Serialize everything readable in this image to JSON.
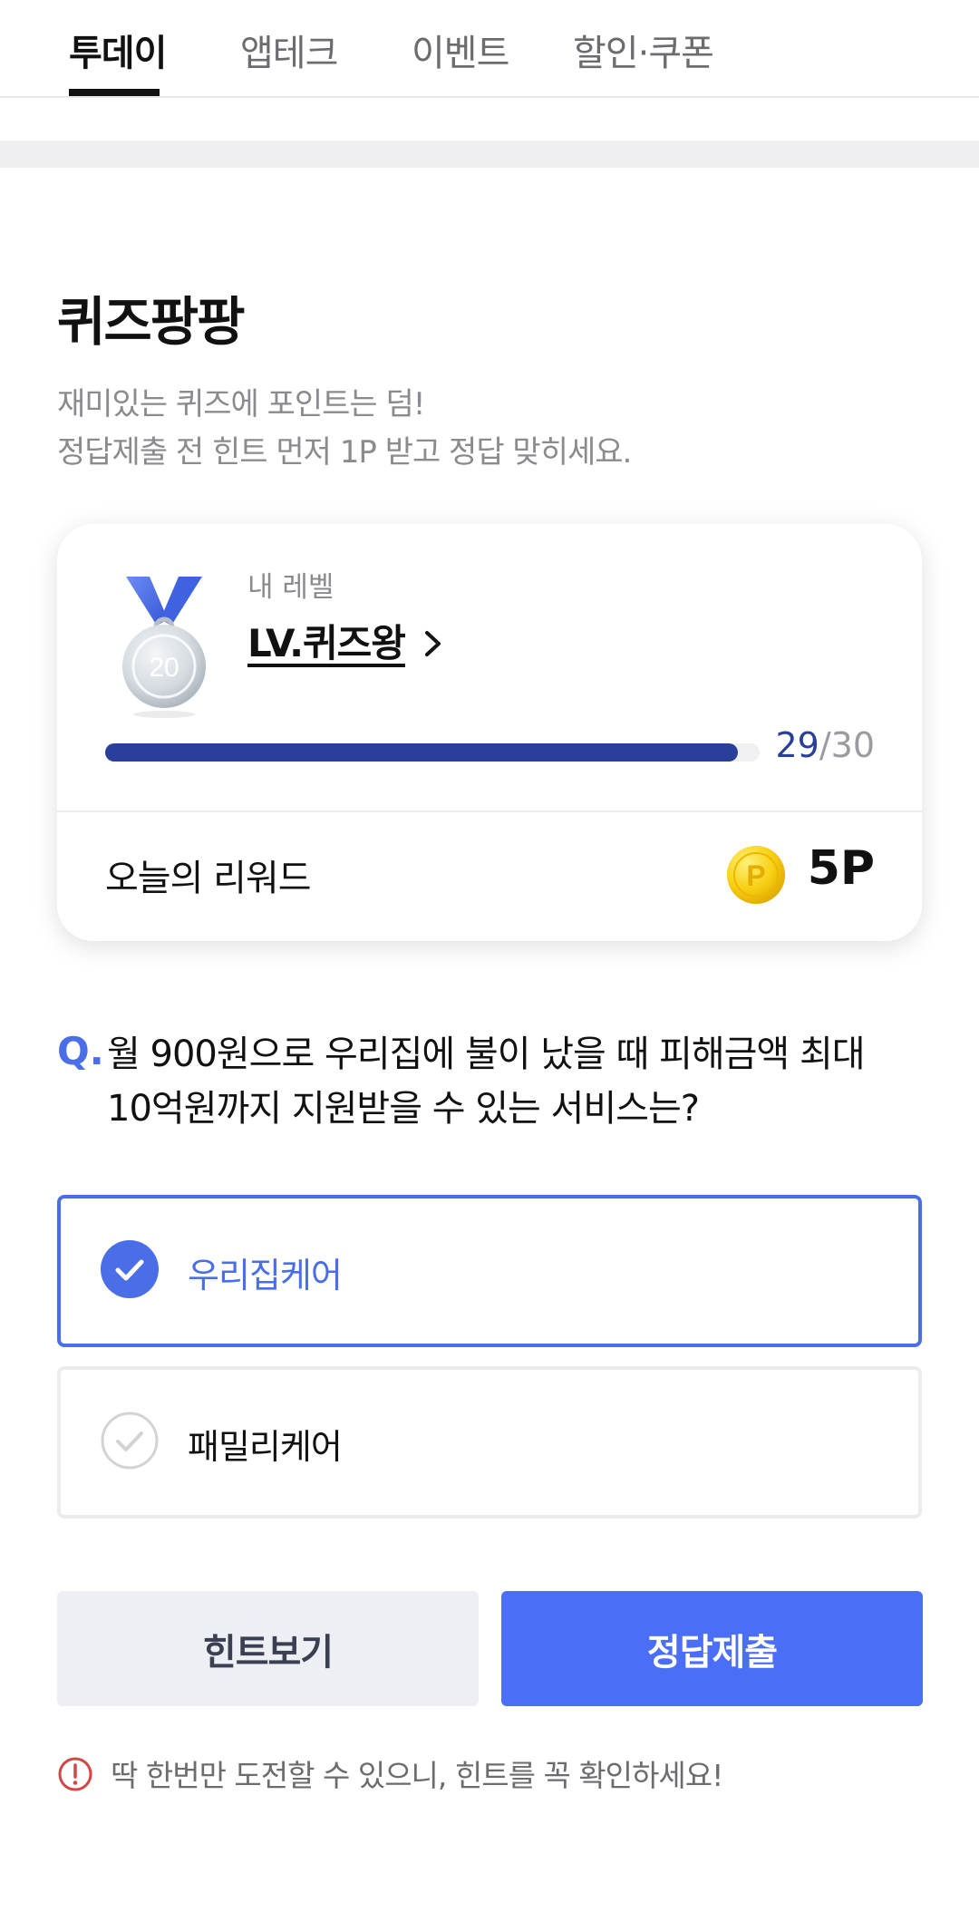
{
  "tabs": [
    {
      "label": "투데이",
      "active": true
    },
    {
      "label": "앱테크",
      "active": false
    },
    {
      "label": "이벤트",
      "active": false
    },
    {
      "label": "할인·쿠폰",
      "active": false
    }
  ],
  "quiz": {
    "title": "퀴즈팡팡",
    "description_line1": "재미있는 퀴즈에 포인트는 덤!",
    "description_line2": "정답제출 전 힌트 먼저 1P 받고 정답 맞히세요."
  },
  "level_card": {
    "medal_number": "20",
    "medal_icon": "silver-medal-icon",
    "label": "내 레벨",
    "level_name": "LV.퀴즈왕",
    "progress_current": "29",
    "progress_separator": "/",
    "progress_total": "30",
    "progress_fraction": 0.967,
    "reward_label": "오늘의 리워드",
    "reward_icon": "gold-coin-icon",
    "reward_value": "5P"
  },
  "question": {
    "marker": "Q.",
    "line1": "월 900원으로 우리집에 불이 났을 때 피해금액 최대",
    "line2": "10억원까지 지원받을 수 있는 서비스는?"
  },
  "options": [
    {
      "label": "우리집케어",
      "selected": true
    },
    {
      "label": "패밀리케어",
      "selected": false
    }
  ],
  "buttons": {
    "hint_label": "힌트보기",
    "submit_label": "정답제출"
  },
  "warning": {
    "icon": "exclamation-circle-icon",
    "text": "딱 한번만 도전할 수 있으니, 힌트를 꼭 확인하세요!"
  },
  "colors": {
    "accent": "#4a6ee8",
    "button_primary": "#4a6ef5",
    "progress_fill": "#2a3f9a",
    "warning_red": "#d64545",
    "coin_gold": "#f2c200"
  }
}
